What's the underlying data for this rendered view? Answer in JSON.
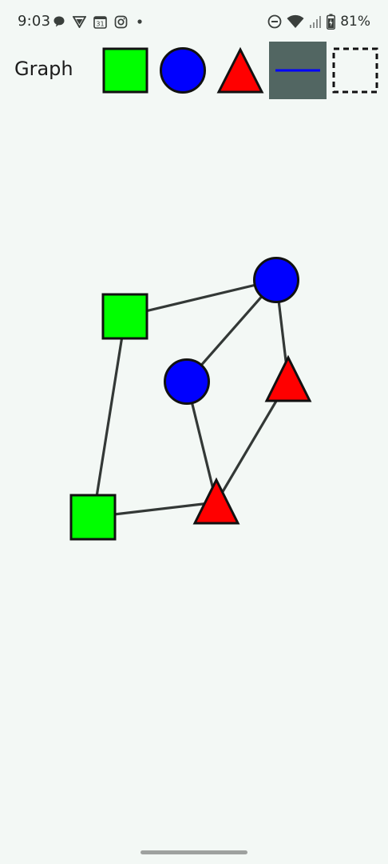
{
  "status_bar": {
    "time": "9:03",
    "left_icons": [
      "chat-bubble-icon",
      "vpn-shield-icon",
      "calendar-31-icon",
      "instagram-icon",
      "dot-icon"
    ],
    "calendar_day": "31",
    "right_icons": [
      "do-not-disturb-icon",
      "wifi-icon",
      "cell-signal-icon",
      "battery-charging-icon"
    ],
    "battery": "81%"
  },
  "toolbar": {
    "title": "Graph",
    "tools": [
      {
        "id": "square",
        "icon": "green-square-icon",
        "color": "#00ff00",
        "selected": false
      },
      {
        "id": "circle",
        "icon": "blue-circle-icon",
        "color": "#0000ff",
        "selected": false
      },
      {
        "id": "triangle",
        "icon": "red-triangle-icon",
        "color": "#ff0000",
        "selected": false
      },
      {
        "id": "edge",
        "icon": "line-edge-icon",
        "color": "#0000ff",
        "selected": true
      },
      {
        "id": "select",
        "icon": "dashed-selection-icon",
        "color": "#000000",
        "selected": false
      }
    ],
    "selected_background": "#526662"
  },
  "graph": {
    "edge_color": "#333836",
    "nodes": [
      {
        "id": "sq1",
        "shape": "square",
        "color": "#00ff00"
      },
      {
        "id": "sq2",
        "shape": "square",
        "color": "#00ff00"
      },
      {
        "id": "c1",
        "shape": "circle",
        "color": "#0000ff"
      },
      {
        "id": "c2",
        "shape": "circle",
        "color": "#0000ff"
      },
      {
        "id": "t1",
        "shape": "triangle",
        "color": "#ff0000"
      },
      {
        "id": "t2",
        "shape": "triangle",
        "color": "#ff0000"
      }
    ],
    "edges": [
      [
        "sq1",
        "c1"
      ],
      [
        "sq1",
        "sq2"
      ],
      [
        "c1",
        "c2"
      ],
      [
        "c1",
        "t1"
      ],
      [
        "c2",
        "t2"
      ],
      [
        "t1",
        "t2"
      ],
      [
        "sq2",
        "t2"
      ]
    ]
  }
}
